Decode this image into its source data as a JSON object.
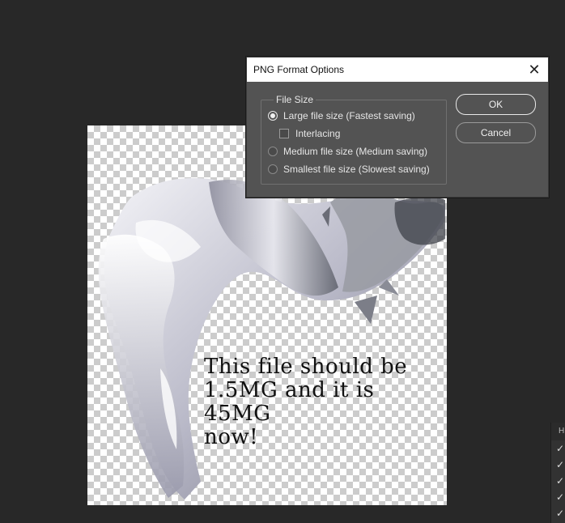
{
  "dialog": {
    "title": "PNG Format Options",
    "close_icon": "close-icon",
    "file_size": {
      "legend": "File Size",
      "options": [
        {
          "label": "Large file size (Fastest saving)",
          "selected": true
        },
        {
          "label": "Interlacing",
          "checked": false
        },
        {
          "label": "Medium file size (Medium saving)",
          "selected": false
        },
        {
          "label": "Smallest file size (Slowest saving)",
          "selected": false
        }
      ]
    },
    "ok_label": "OK",
    "cancel_label": "Cancel"
  },
  "canvas": {
    "text": "This file should be\n1.5MG and it is 45MG\nnow!",
    "text_color": "#111111"
  },
  "side_panel": {
    "header": "H",
    "checkmarks": [
      "✓",
      "✓",
      "✓",
      "✓",
      "✓"
    ]
  },
  "colors": {
    "workspace": "#282828",
    "dialog_bg": "#535353",
    "dialog_title_bg": "#ffffff"
  }
}
